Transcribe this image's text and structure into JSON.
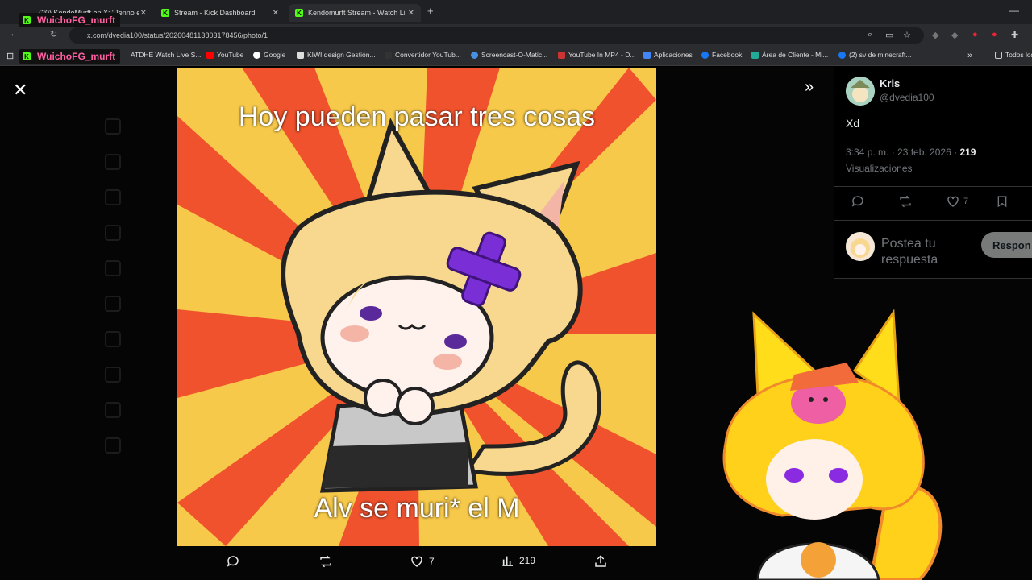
{
  "tabs": [
    {
      "label": "(20) KendoMurft en X: \"Jenno e",
      "active": false
    },
    {
      "label": "Stream - Kick Dashboard",
      "active": false
    },
    {
      "label": "Kendomurft Stream - Watch Liv",
      "active": true
    }
  ],
  "address": {
    "url": "x.com/dvedia100/status/2026048113803178456/photo/1"
  },
  "bookmarks": [
    "ATDHE Watch Live S...",
    "YouTube",
    "Google",
    "KIWI design Gestión...",
    "Convertidor YouTub...",
    "Screencast-O-Matic...",
    "YouTube In MP4 - D...",
    "Aplicaciones",
    "Facebook",
    "Área de Cliente - Mi...",
    "(2) sv de minecraft...",
    "Todos los"
  ],
  "overlay_name": "WuichoFG_murft",
  "meme": {
    "top_text": "Hoy pueden pasar tres cosas",
    "bottom_text": "Alv se muri* el M"
  },
  "photo_actions": {
    "likes": "7",
    "views": "219"
  },
  "post": {
    "author": "Kris",
    "handle": "@dvedia100",
    "text": "Xd",
    "time": "3:34 p. m. · 23 feb. 2026 ·",
    "views": "219",
    "views_label": "Visualizaciones",
    "likes": "7",
    "reply_placeholder": "Postea tu respuesta",
    "reply_button": "Respon"
  },
  "colors": {
    "meme_bg_yellow": "#f7c94a",
    "meme_ray_orange": "#f0522d",
    "kick_green": "#53fc18",
    "overlay_pink": "#ff5fa2"
  }
}
